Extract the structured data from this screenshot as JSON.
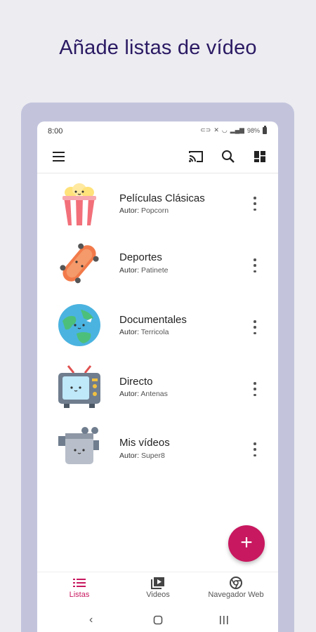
{
  "headline": "Añade listas de vídeo",
  "status": {
    "time": "8:00",
    "battery": "98%"
  },
  "toolbar": {
    "menu_icon": "hamburger-icon",
    "cast_icon": "cast-icon",
    "search_icon": "search-icon",
    "layout_icon": "grid-layout-icon"
  },
  "playlists": [
    {
      "title": "Películas Clásicas",
      "author_label": "Autor:",
      "author": "Popcorn",
      "icon": "popcorn-icon"
    },
    {
      "title": "Deportes",
      "author_label": "Autor:",
      "author": "Patinete",
      "icon": "skateboard-icon"
    },
    {
      "title": "Documentales",
      "author_label": "Autor:",
      "author": "Terricola",
      "icon": "earth-icon"
    },
    {
      "title": "Directo",
      "author_label": "Autor:",
      "author": "Antenas",
      "icon": "tv-icon"
    },
    {
      "title": "Mis vídeos",
      "author_label": "Autor:",
      "author": "Super8",
      "icon": "camera-icon"
    }
  ],
  "fab": {
    "label": "+",
    "icon": "add-icon"
  },
  "bottom_nav": [
    {
      "label": "Listas",
      "icon": "list-icon",
      "active": true
    },
    {
      "label": "Videos",
      "icon": "video-library-icon",
      "active": false
    },
    {
      "label": "Navegador Web",
      "icon": "browser-icon",
      "active": false
    }
  ],
  "colors": {
    "accent": "#c8185f",
    "headline": "#2b1a63",
    "frame": "#c3c4dc",
    "background": "#ececf1"
  }
}
